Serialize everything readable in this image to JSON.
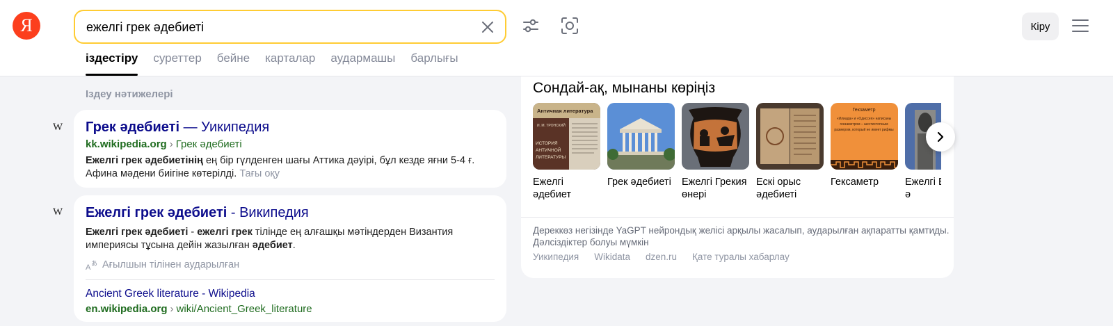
{
  "header": {
    "logo_glyph": "Я",
    "search_value": "ежелгі грек әдебиеті",
    "login_label": "Кіру"
  },
  "tabs": [
    {
      "label": "іздестіру",
      "active": true
    },
    {
      "label": "суреттер"
    },
    {
      "label": "бейне"
    },
    {
      "label": "карталар"
    },
    {
      "label": "аудармашы"
    },
    {
      "label": "барлығы"
    }
  ],
  "results_heading": "Іздеу нәтижелері",
  "results": [
    {
      "favicon": "W",
      "title_bold": "Грек әдебиеті",
      "title_rest": " — Уикипедия",
      "url_domain": "kk.wikipedia.org",
      "url_sep": "›",
      "url_path": "Грек әдебиеті",
      "snippet_bold": "Ежелгі грек әдебиетінің",
      "snippet_rest": " ең бір гүлденген шағы Аттика дәуірі, бұл кезде яғни 5-4 ғ. Афина мәдени биігіне көтерілді.",
      "more": "Тағы оқу"
    },
    {
      "favicon": "W",
      "title_bold": "Ежелгі грек әдебиеті",
      "title_rest": " - Википедия",
      "snippet_b1": "Ежелгі грек әдебиеті",
      "snippet_t1": " - ",
      "snippet_b2": "ежелгі грек",
      "snippet_t2": " тілінде ең алғашқы мәтіндерден Византия империясы тұсына дейін жазылған ",
      "snippet_b3": "әдебиет",
      "snippet_t3": ".",
      "translated_label": "Ағылшын тілінен аударылған",
      "sub_title": "Ancient Greek literature - Wikipedia",
      "sub_url_domain": "en.wikipedia.org",
      "sub_url_sep": "›",
      "sub_url_path": "wiki/Ancient_Greek_literature"
    }
  ],
  "see_also": {
    "title": "Сондай-ақ, мынаны көріңіз",
    "items": [
      {
        "label": "Ежелгі әдебиет",
        "img_text_top": "Античная литература",
        "img_text_bottom": "ИСТОРИЯ АНТИЧНОЙ ЛИТЕРАТУРЫ",
        "img_text_small": "И. М. ТРОНСКИЙ"
      },
      {
        "label": "Грек әдебиеті"
      },
      {
        "label": "Ежелгі Грекия өнері"
      },
      {
        "label": "Ескі орыс әдебиеті"
      },
      {
        "label": "Гексаметр",
        "img_text_top": "Гекзаметр",
        "img_text_body": "«Илиада» и «Одиссея» написаны гекзаметром – шестистопным размером, который не имеет рифмы"
      },
      {
        "label": "Ежелгі Египет ә"
      }
    ],
    "disclaimer": "Дереккөз негізінде YaGPT нейрондық желісі арқылы жасалып, аударылған ақпаратты қамтиды. Дәлсіздіктер болуы мүмкін",
    "sources": [
      "Уикипедия",
      "Wikidata",
      "dzen.ru",
      "Қате туралы хабарлау"
    ]
  },
  "colors": {
    "logo": "#fc3f1d",
    "search_border": "#ffcc33",
    "link": "#0c0c8c",
    "url": "#1e6b1e"
  }
}
